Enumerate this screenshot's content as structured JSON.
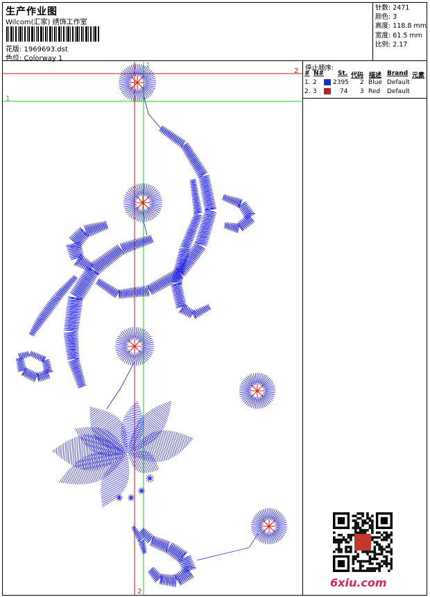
{
  "header": {
    "title": "生产作业图",
    "subtitle": "Wilcom(汇家) 绣饰工作室",
    "file_label": "花版: 1969693.dst",
    "color_label": "色位: Colorway 1"
  },
  "stats": {
    "stitches": "针数: 2471",
    "colors": "颜色: 3",
    "height": "高度: 118.8 mm",
    "width": "宽度: 61.5 mm",
    "scale": "比例: 2.17"
  },
  "stop_sequence": {
    "title": "停止顺序:",
    "headers": [
      "#",
      "N#",
      "St.",
      "代码",
      "描述",
      "Brand",
      "元素"
    ],
    "rows": [
      {
        "idx": "1.",
        "needle": "2",
        "swatch": "#0a2fe0",
        "stitches": "2395",
        "code": "2",
        "desc": "Blue",
        "brand": "Default"
      },
      {
        "idx": "2.",
        "needle": "3",
        "swatch": "#e01010",
        "stitches": "74",
        "code": "3",
        "desc": "Red",
        "brand": "Default"
      }
    ]
  },
  "guides": {
    "h_red_label": "2",
    "h_green_label": "1",
    "v_green_label": "1",
    "v_red_label": "2"
  },
  "colors": {
    "blue": "#1a1ae6",
    "red": "#e01010",
    "green": "#18c818"
  },
  "watermark": "6xiu.com"
}
